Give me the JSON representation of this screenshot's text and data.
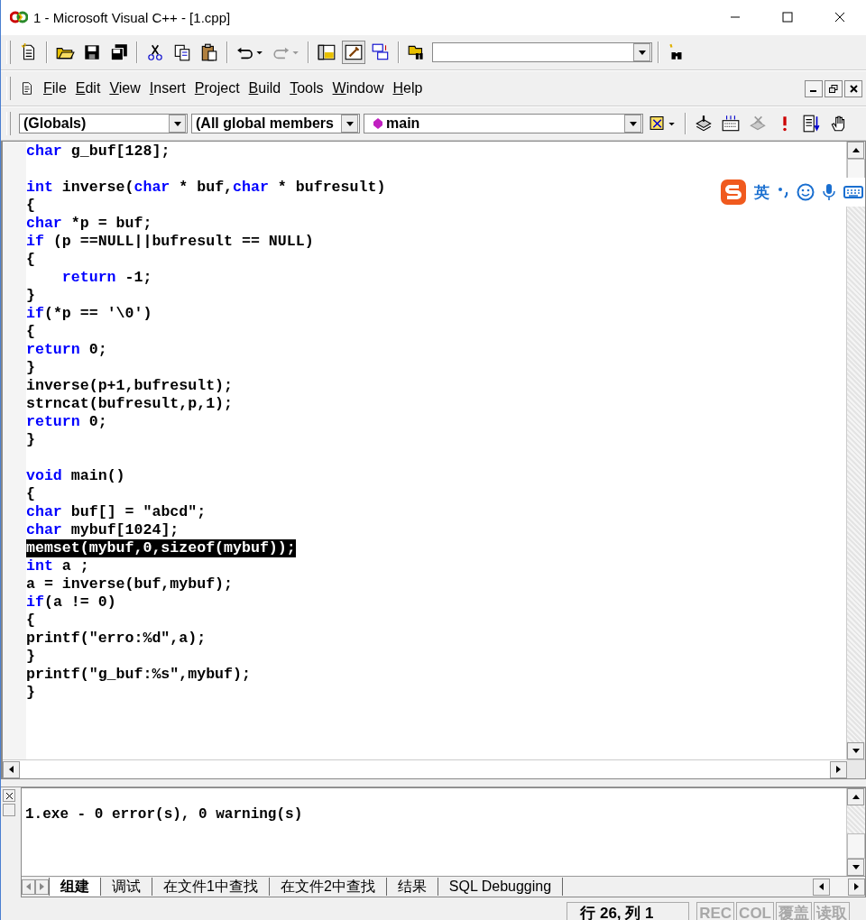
{
  "window": {
    "title": "1 - Microsoft Visual C++ - [1.cpp]"
  },
  "menu": [
    {
      "label": "File"
    },
    {
      "label": "Edit"
    },
    {
      "label": "View"
    },
    {
      "label": "Insert"
    },
    {
      "label": "Project"
    },
    {
      "label": "Build"
    },
    {
      "label": "Tools"
    },
    {
      "label": "Window"
    },
    {
      "label": "Help"
    }
  ],
  "wizard_bar": {
    "class_combo": "(Globals)",
    "filter_combo": "(All global members",
    "members_combo": "main"
  },
  "ime_toolbar": {
    "mode": "英"
  },
  "code": {
    "lines": [
      {
        "selected": false,
        "tokens": [
          {
            "kind": "keyword",
            "text": "char"
          },
          {
            "kind": "text",
            "text": " g_buf[128];"
          }
        ]
      },
      {
        "selected": false
      },
      {
        "selected": false,
        "tokens": [
          {
            "kind": "keyword",
            "text": "int"
          },
          {
            "kind": "text",
            "text": " inverse("
          },
          {
            "kind": "keyword",
            "text": "char"
          },
          {
            "kind": "text",
            "text": " * buf,"
          },
          {
            "kind": "keyword",
            "text": "char"
          },
          {
            "kind": "text",
            "text": " * bufresult)"
          }
        ]
      },
      {
        "selected": false,
        "tokens": [
          {
            "kind": "text",
            "text": "{"
          }
        ]
      },
      {
        "selected": false,
        "tokens": [
          {
            "kind": "keyword",
            "text": "char"
          },
          {
            "kind": "text",
            "text": " *p = buf;"
          }
        ]
      },
      {
        "selected": false,
        "tokens": [
          {
            "kind": "keyword",
            "text": "if"
          },
          {
            "kind": "text",
            "text": " (p ==NULL||bufresult == NULL)"
          }
        ]
      },
      {
        "selected": false,
        "tokens": [
          {
            "kind": "text",
            "text": "{"
          }
        ]
      },
      {
        "selected": false,
        "tokens": [
          {
            "kind": "keyword",
            "text": "    return"
          },
          {
            "kind": "text",
            "text": " -1;"
          }
        ]
      },
      {
        "selected": false,
        "tokens": [
          {
            "kind": "text",
            "text": "}"
          }
        ]
      },
      {
        "selected": false,
        "tokens": [
          {
            "kind": "keyword",
            "text": "if"
          },
          {
            "kind": "text",
            "text": "(*p == '\\0')"
          }
        ]
      },
      {
        "selected": false,
        "tokens": [
          {
            "kind": "text",
            "text": "{"
          }
        ]
      },
      {
        "selected": false,
        "tokens": [
          {
            "kind": "keyword",
            "text": "return"
          },
          {
            "kind": "text",
            "text": " 0;"
          }
        ]
      },
      {
        "selected": false,
        "tokens": [
          {
            "kind": "text",
            "text": "}"
          }
        ]
      },
      {
        "selected": false,
        "tokens": [
          {
            "kind": "text",
            "text": "inverse(p+1,bufresult);"
          }
        ]
      },
      {
        "selected": false,
        "tokens": [
          {
            "kind": "text",
            "text": "strncat(bufresult,p,1);"
          }
        ]
      },
      {
        "selected": false,
        "tokens": [
          {
            "kind": "keyword",
            "text": "return"
          },
          {
            "kind": "text",
            "text": " 0;"
          }
        ]
      },
      {
        "selected": false,
        "tokens": [
          {
            "kind": "text",
            "text": "}"
          }
        ]
      },
      {
        "selected": false
      },
      {
        "selected": false,
        "tokens": [
          {
            "kind": "keyword",
            "text": "void"
          },
          {
            "kind": "text",
            "text": " main()"
          }
        ]
      },
      {
        "selected": false,
        "tokens": [
          {
            "kind": "text",
            "text": "{"
          }
        ]
      },
      {
        "selected": false,
        "tokens": [
          {
            "kind": "keyword",
            "text": "char"
          },
          {
            "kind": "text",
            "text": " buf[] = \"abcd\";"
          }
        ]
      },
      {
        "selected": false,
        "tokens": [
          {
            "kind": "keyword",
            "text": "char"
          },
          {
            "kind": "text",
            "text": " mybuf[1024];"
          }
        ]
      },
      {
        "selected": true,
        "tokens": [
          {
            "kind": "text",
            "text": "memset(mybuf,0,sizeof(mybuf));"
          }
        ]
      },
      {
        "selected": false,
        "tokens": [
          {
            "kind": "keyword",
            "text": "int"
          },
          {
            "kind": "text",
            "text": " a ;"
          }
        ]
      },
      {
        "selected": false,
        "tokens": [
          {
            "kind": "text",
            "text": "a = inverse(buf,mybuf);"
          }
        ]
      },
      {
        "selected": false,
        "tokens": [
          {
            "kind": "keyword",
            "text": "if"
          },
          {
            "kind": "text",
            "text": "(a != 0)"
          }
        ]
      },
      {
        "selected": false,
        "tokens": [
          {
            "kind": "text",
            "text": "{"
          }
        ]
      },
      {
        "selected": false,
        "tokens": [
          {
            "kind": "text",
            "text": "printf(\"erro:%d\",a);"
          }
        ]
      },
      {
        "selected": false,
        "tokens": [
          {
            "kind": "text",
            "text": "}"
          }
        ]
      },
      {
        "selected": false,
        "tokens": [
          {
            "kind": "text",
            "text": "printf(\"g_buf:%s\",mybuf);"
          }
        ]
      },
      {
        "selected": false,
        "tokens": [
          {
            "kind": "text",
            "text": "}"
          }
        ]
      }
    ]
  },
  "output": {
    "lines": [
      "1.exe - 0 error(s), 0 warning(s)"
    ],
    "tabs": [
      {
        "label": "组建",
        "selected": true
      },
      {
        "label": "调试",
        "selected": false
      },
      {
        "label": "在文件1中查找",
        "selected": false
      },
      {
        "label": "在文件2中查找",
        "selected": false
      },
      {
        "label": "结果",
        "selected": false
      },
      {
        "label": "SQL Debugging",
        "selected": false
      }
    ]
  },
  "status_bar": {
    "position": "行 26, 列 1",
    "indicators": [
      {
        "label": "REC",
        "disabled": true
      },
      {
        "label": "COL",
        "disabled": true
      },
      {
        "label": "覆盖",
        "disabled": true
      },
      {
        "label": "读取",
        "disabled": true
      }
    ]
  }
}
